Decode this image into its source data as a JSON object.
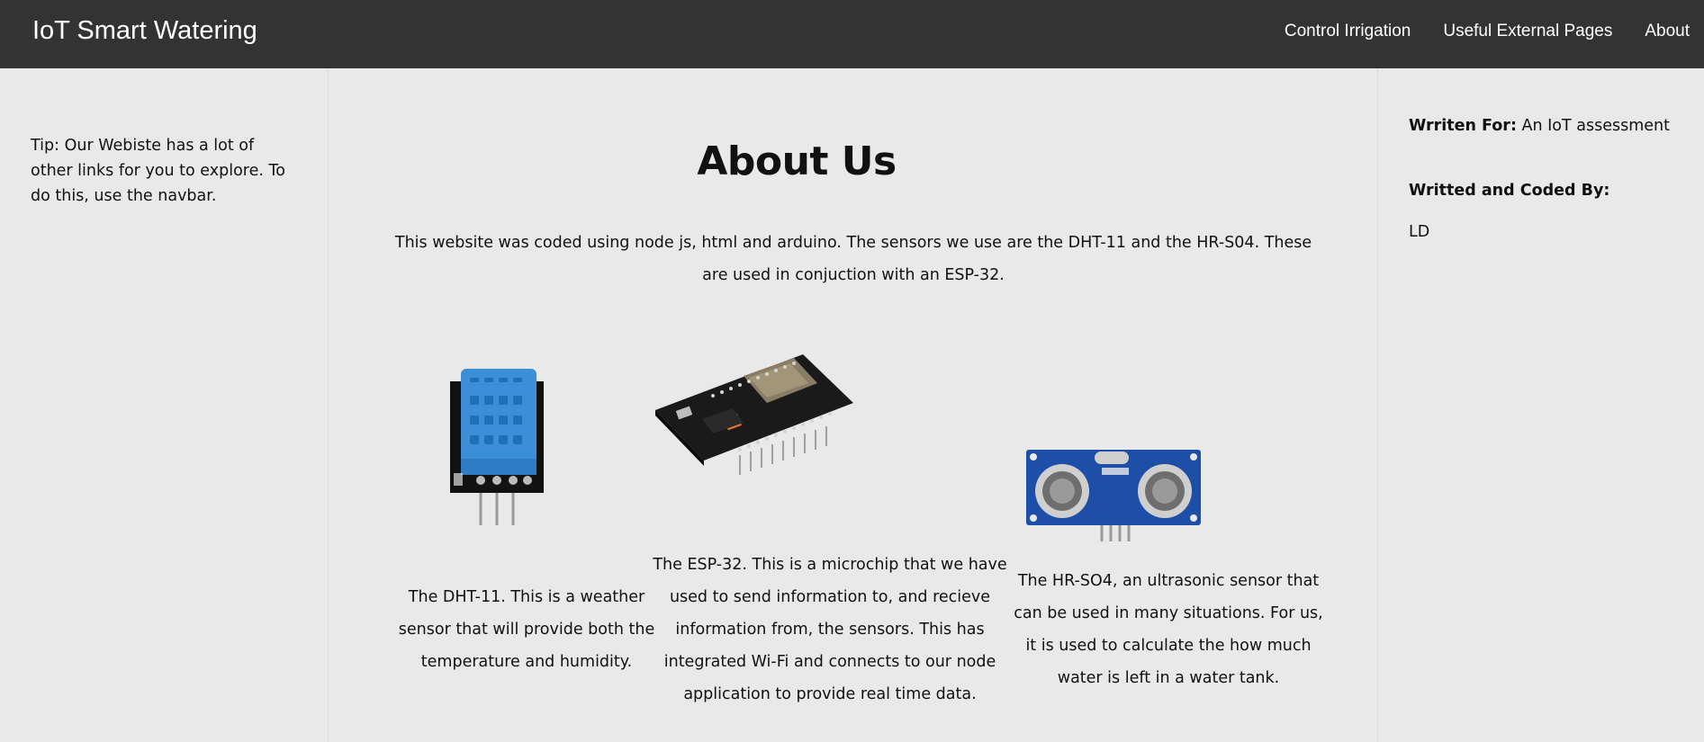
{
  "navbar": {
    "brand": "IoT Smart Watering",
    "links": [
      "Control Irrigation",
      "Useful External Pages",
      "About"
    ]
  },
  "sidebar_left": {
    "tip": "Tip: Our Webiste has a lot of other links for you to explore. To do this, use the navbar."
  },
  "main": {
    "title": "About Us",
    "intro": "This website was coded using node js, html and arduino. The sensors we use are the DHT-11 and the HR-S04. These are used in conjuction with an ESP-32.",
    "sensors": [
      {
        "name": "DHT-11",
        "icon": "dht11-sensor-image",
        "description": "The DHT-11. This is a weather sensor that will provide both the temperature and humidity."
      },
      {
        "name": "ESP-32",
        "icon": "esp32-board-image",
        "description": "The ESP-32. This is a microchip that we have used to send information to, and recieve information from, the sensors. This has integrated Wi-Fi and connects to our node application to provide real time data."
      },
      {
        "name": "HR-SO4",
        "icon": "hcsr04-sensor-image",
        "description": "The HR-SO4, an ultrasonic sensor that can be used in many situations. For us, it is used to calculate the how much water is left in a water tank."
      }
    ]
  },
  "sidebar_right": {
    "written_for_label": "Wrriten For:",
    "written_for_value": "An IoT assessment",
    "coded_by_label": "Writted and Coded By:",
    "coded_by_value": "LD"
  },
  "colors": {
    "navbar": "#333333",
    "background": "#e9e9e9",
    "dht_blue": "#3a8fd6",
    "board_blue": "#1d4fa8"
  }
}
